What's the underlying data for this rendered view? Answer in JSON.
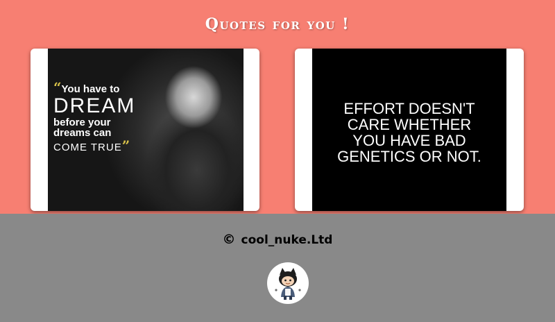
{
  "page": {
    "title": "Quotes for you !"
  },
  "cards": [
    {
      "quote_lines": [
        "You have to",
        "DREAM",
        "before your",
        "dreams can",
        "COME TRUE"
      ],
      "open_mark": "“",
      "close_mark": "”"
    },
    {
      "text": "EFFORT DOESN'T\nCARE WHETHER\nYOU HAVE BAD\nGENETICS OR NOT."
    }
  ],
  "footer": {
    "copyright_symbol": "©",
    "copyright_text": "cool_nuke.Ltd",
    "avatar_icon": "octocat-avatar-icon"
  },
  "colors": {
    "top_background": "#f77f72",
    "bottom_background": "#898989",
    "quote_accent": "#d8c24a"
  }
}
